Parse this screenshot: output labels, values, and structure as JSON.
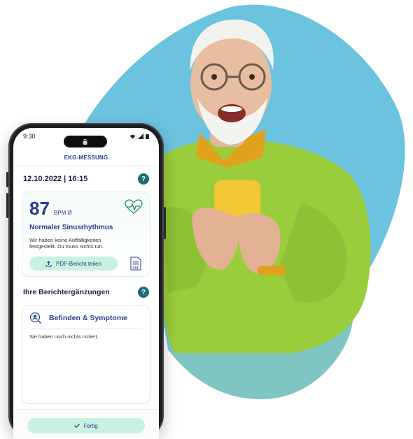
{
  "colors": {
    "brand_navy": "#2f3a8f",
    "teal": "#1d6c7a",
    "mint": "#c9f1e1",
    "blob_blue": "#6cc3e0",
    "blob_teal": "#7fc6c3",
    "sweater_green": "#9acd3c"
  },
  "statusbar": {
    "time": "9:30"
  },
  "app": {
    "title": "EKG-MESSUNG"
  },
  "measurement": {
    "datetime": "12.10.2022 | 16:15",
    "help_icon": "question-icon",
    "bpm_value": "87",
    "bpm_unit": "BPM Ø",
    "rhythm": "Normaler Sinusrhythmus",
    "description": "Wir haben keine Auffälligkeiten festgestellt. Du muss nichts tun.",
    "share_label": "PDF-Bericht teilen",
    "pdf_label": "PDF"
  },
  "supplements": {
    "title": "Ihre Berichtergänzungen",
    "card_title": "Befinden & Symptome",
    "empty_text": "Sie haben noch nichts notiert."
  },
  "footer": {
    "done_label": "Fertig"
  }
}
